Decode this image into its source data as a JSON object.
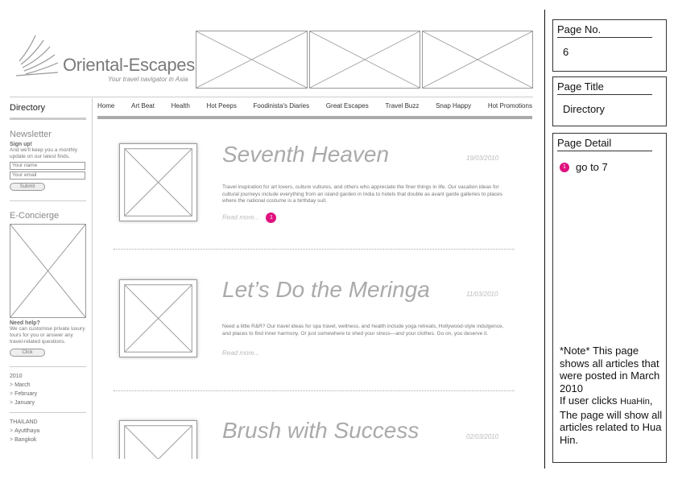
{
  "logo": {
    "name": "Oriental-Escapes",
    "tagline": "Your travel navigator in Asia"
  },
  "nav": {
    "items": [
      "Home",
      "Art Beat",
      "Health",
      "Hot Peeps",
      "Foodinista's Diaries",
      "Great Escapes",
      "Travel Buzz",
      "Snap Happy",
      "Hot Promotions"
    ]
  },
  "sidebar": {
    "title": "Directory",
    "newsletter": {
      "heading": "Newsletter",
      "signup": "Sign up!",
      "desc": "And we'll keep you a monthly update on our latest finds.",
      "name_placeholder": "Your name",
      "email_placeholder": "Your email",
      "submit": "Submit"
    },
    "concierge": {
      "heading": "E-Concierge",
      "help_title": "Need help?",
      "help_desc": "We can customise private luxury tours for you or answer any travel-related questions.",
      "click": "Click"
    },
    "archive": {
      "year": "2010",
      "months": [
        "March",
        "February",
        "January"
      ]
    },
    "places": {
      "heading": "THAILAND",
      "items": [
        "Ayutthaya",
        "Bangkok"
      ]
    }
  },
  "articles": [
    {
      "title": "Seventh Heaven",
      "date": "19/03/2010",
      "body": "Travel inspiration for art lovers, culture vultures, and others who appreciate the finer things in life. Our vacation ideas for cultural journeys include everything from an island garden in India to hotels that double as avant garde galleries to places where the national costume is a birthday suit.",
      "more": "Read more...",
      "marker": "1"
    },
    {
      "title": "Let’s Do the Meringa",
      "date": "11/03/2010",
      "body": "Need a little R&R? Our travel ideas for spa travel, wellness, and health include yoga retreats, Hollywood-style indulgence, and places to find inner harmony. Or just somewhere to shed your stress—and your clothes. Go on, you deserve it.",
      "more": "Read more..."
    },
    {
      "title": "Brush with Success",
      "date": "02/03/2010"
    }
  ],
  "panel": {
    "page_no_label": "Page No.",
    "page_no": "6",
    "page_title_label": "Page Title",
    "page_title": "Directory",
    "page_detail_label": "Page Detail",
    "detail_marker": "1",
    "detail_text": "go to 7",
    "note_1": "*Note* This page shows all articles that were posted in March 2010",
    "note_2a": "If user clicks ",
    "note_2b": "HuaHin",
    "note_2c": ", The page will show all articles related to Hua Hin."
  },
  "colors": {
    "marker": "#e0117f",
    "wire": "#999999"
  }
}
